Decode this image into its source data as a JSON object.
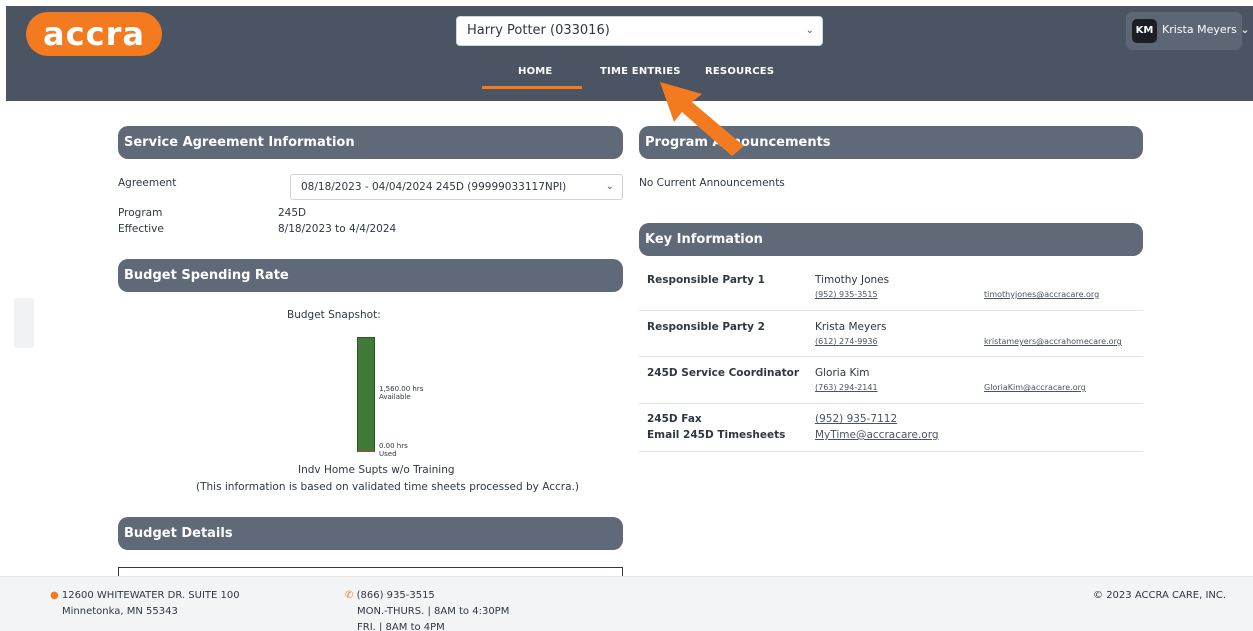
{
  "header": {
    "logo_text": "accra",
    "client_select_value": "Harry Potter (033016)",
    "user_initials": "KM",
    "user_name": "Krista Meyers",
    "nav": [
      "HOME",
      "TIME ENTRIES",
      "RESOURCES"
    ],
    "active_nav": "HOME"
  },
  "service_agreement": {
    "title": "Service Agreement Information",
    "agreement_label": "Agreement",
    "agreement_value": "08/18/2023 - 04/04/2024 245D (99999033117NPI)",
    "program_label": "Program",
    "program_value": "245D",
    "effective_label": "Effective",
    "effective_value": "8/18/2023 to 4/4/2024"
  },
  "budget_spending": {
    "title": "Budget Spending Rate",
    "snapshot_label": "Budget Snapshot:",
    "available_hours": "1,560.00 hrs",
    "available_label": "Available",
    "used_hours": "0.00 hrs",
    "used_label": "Used",
    "used_fraction": 0.0,
    "service_name": "Indv Home Supts w/o Training",
    "note": "(This information is based on validated time sheets processed by Accra.)"
  },
  "budget_details": {
    "title": "Budget Details"
  },
  "announcements": {
    "title": "Program Announcements",
    "empty_text": "No Current Announcements"
  },
  "key_information": {
    "title": "Key Information",
    "rows": [
      {
        "title": "Responsible Party 1",
        "name": "Timothy Jones",
        "phone": "(952) 935-3515",
        "email": "timothyjones@accracare.org"
      },
      {
        "title": "Responsible Party 2",
        "name": "Krista Meyers",
        "phone": "(612) 274-9936",
        "email": "kristameyers@accrahomecare.org"
      },
      {
        "title": "245D Service Coordinator",
        "name": "Gloria Kim",
        "phone": "(763) 294-2141",
        "email": "GloriaKim@accracare.org"
      }
    ],
    "fax_label": "245D Fax",
    "fax_value": "(952) 935-7112",
    "email_label": "Email 245D Timesheets",
    "email_value": "MyTime@accracare.org"
  },
  "footer": {
    "address_line1": "12600 WHITEWATER DR. SUITE 100",
    "address_line2": "Minnetonka, MN 55343",
    "phone": "(866) 935-3515",
    "hours_line1": "MON.-THURS. | 8AM to 4:30PM",
    "hours_line2": "FRI. | 8AM to 4PM",
    "copyright": "2023 ACCRA CARE, INC."
  },
  "colors": {
    "brand_orange": "#f47a20",
    "header_bg": "#4a5463",
    "card_header_bg": "#5f6977",
    "bar_green": "#3f7b36"
  },
  "icons": [
    "chevron-down-icon",
    "location-pin-icon",
    "phone-icon",
    "copyright-icon",
    "pointer-arrow-icon"
  ]
}
